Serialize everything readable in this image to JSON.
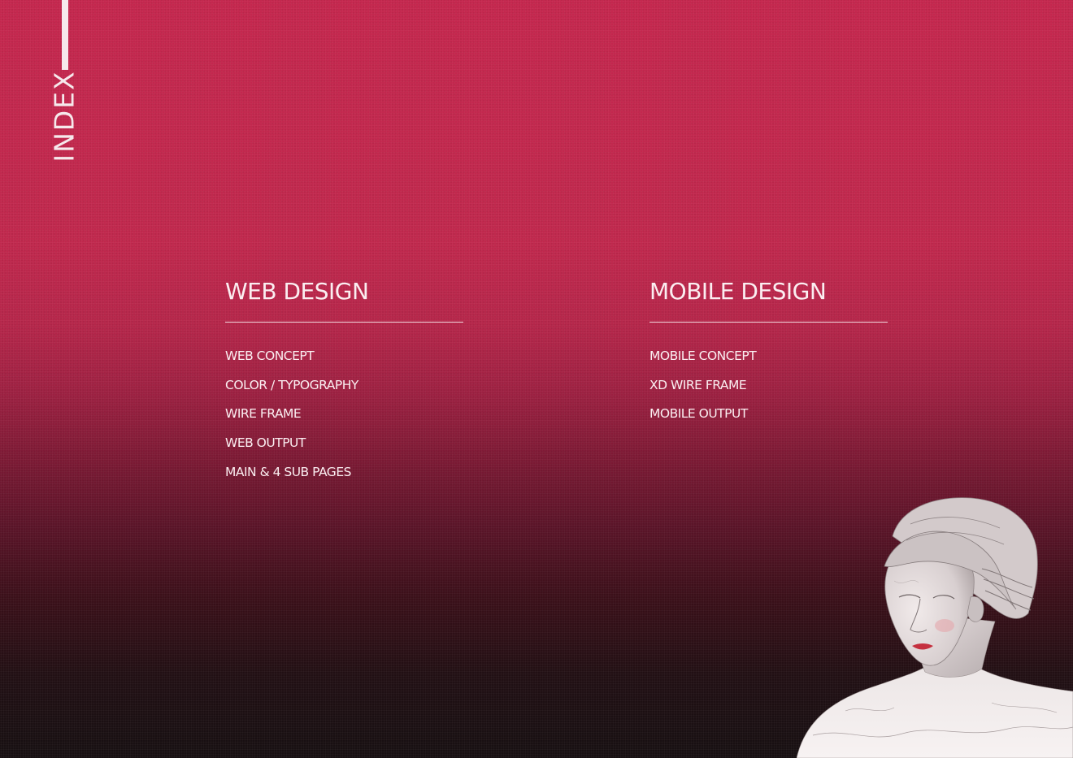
{
  "index": {
    "label": "INDEX"
  },
  "web": {
    "title": "WEB DESIGN",
    "items": [
      "WEB CONCEPT",
      "COLOR / TYPOGRAPHY",
      "WIRE FRAME",
      "WEB OUTPUT",
      "MAIN & 4 SUB PAGES"
    ]
  },
  "mobile": {
    "title": "MOBILE DESIGN",
    "items": [
      "MOBILE CONCEPT",
      "XD WIRE FRAME",
      "MOBILE OUTPUT"
    ]
  },
  "colors": {
    "background_top": "#c4274e",
    "background_bottom": "#171012",
    "text": "#fbeef1"
  }
}
